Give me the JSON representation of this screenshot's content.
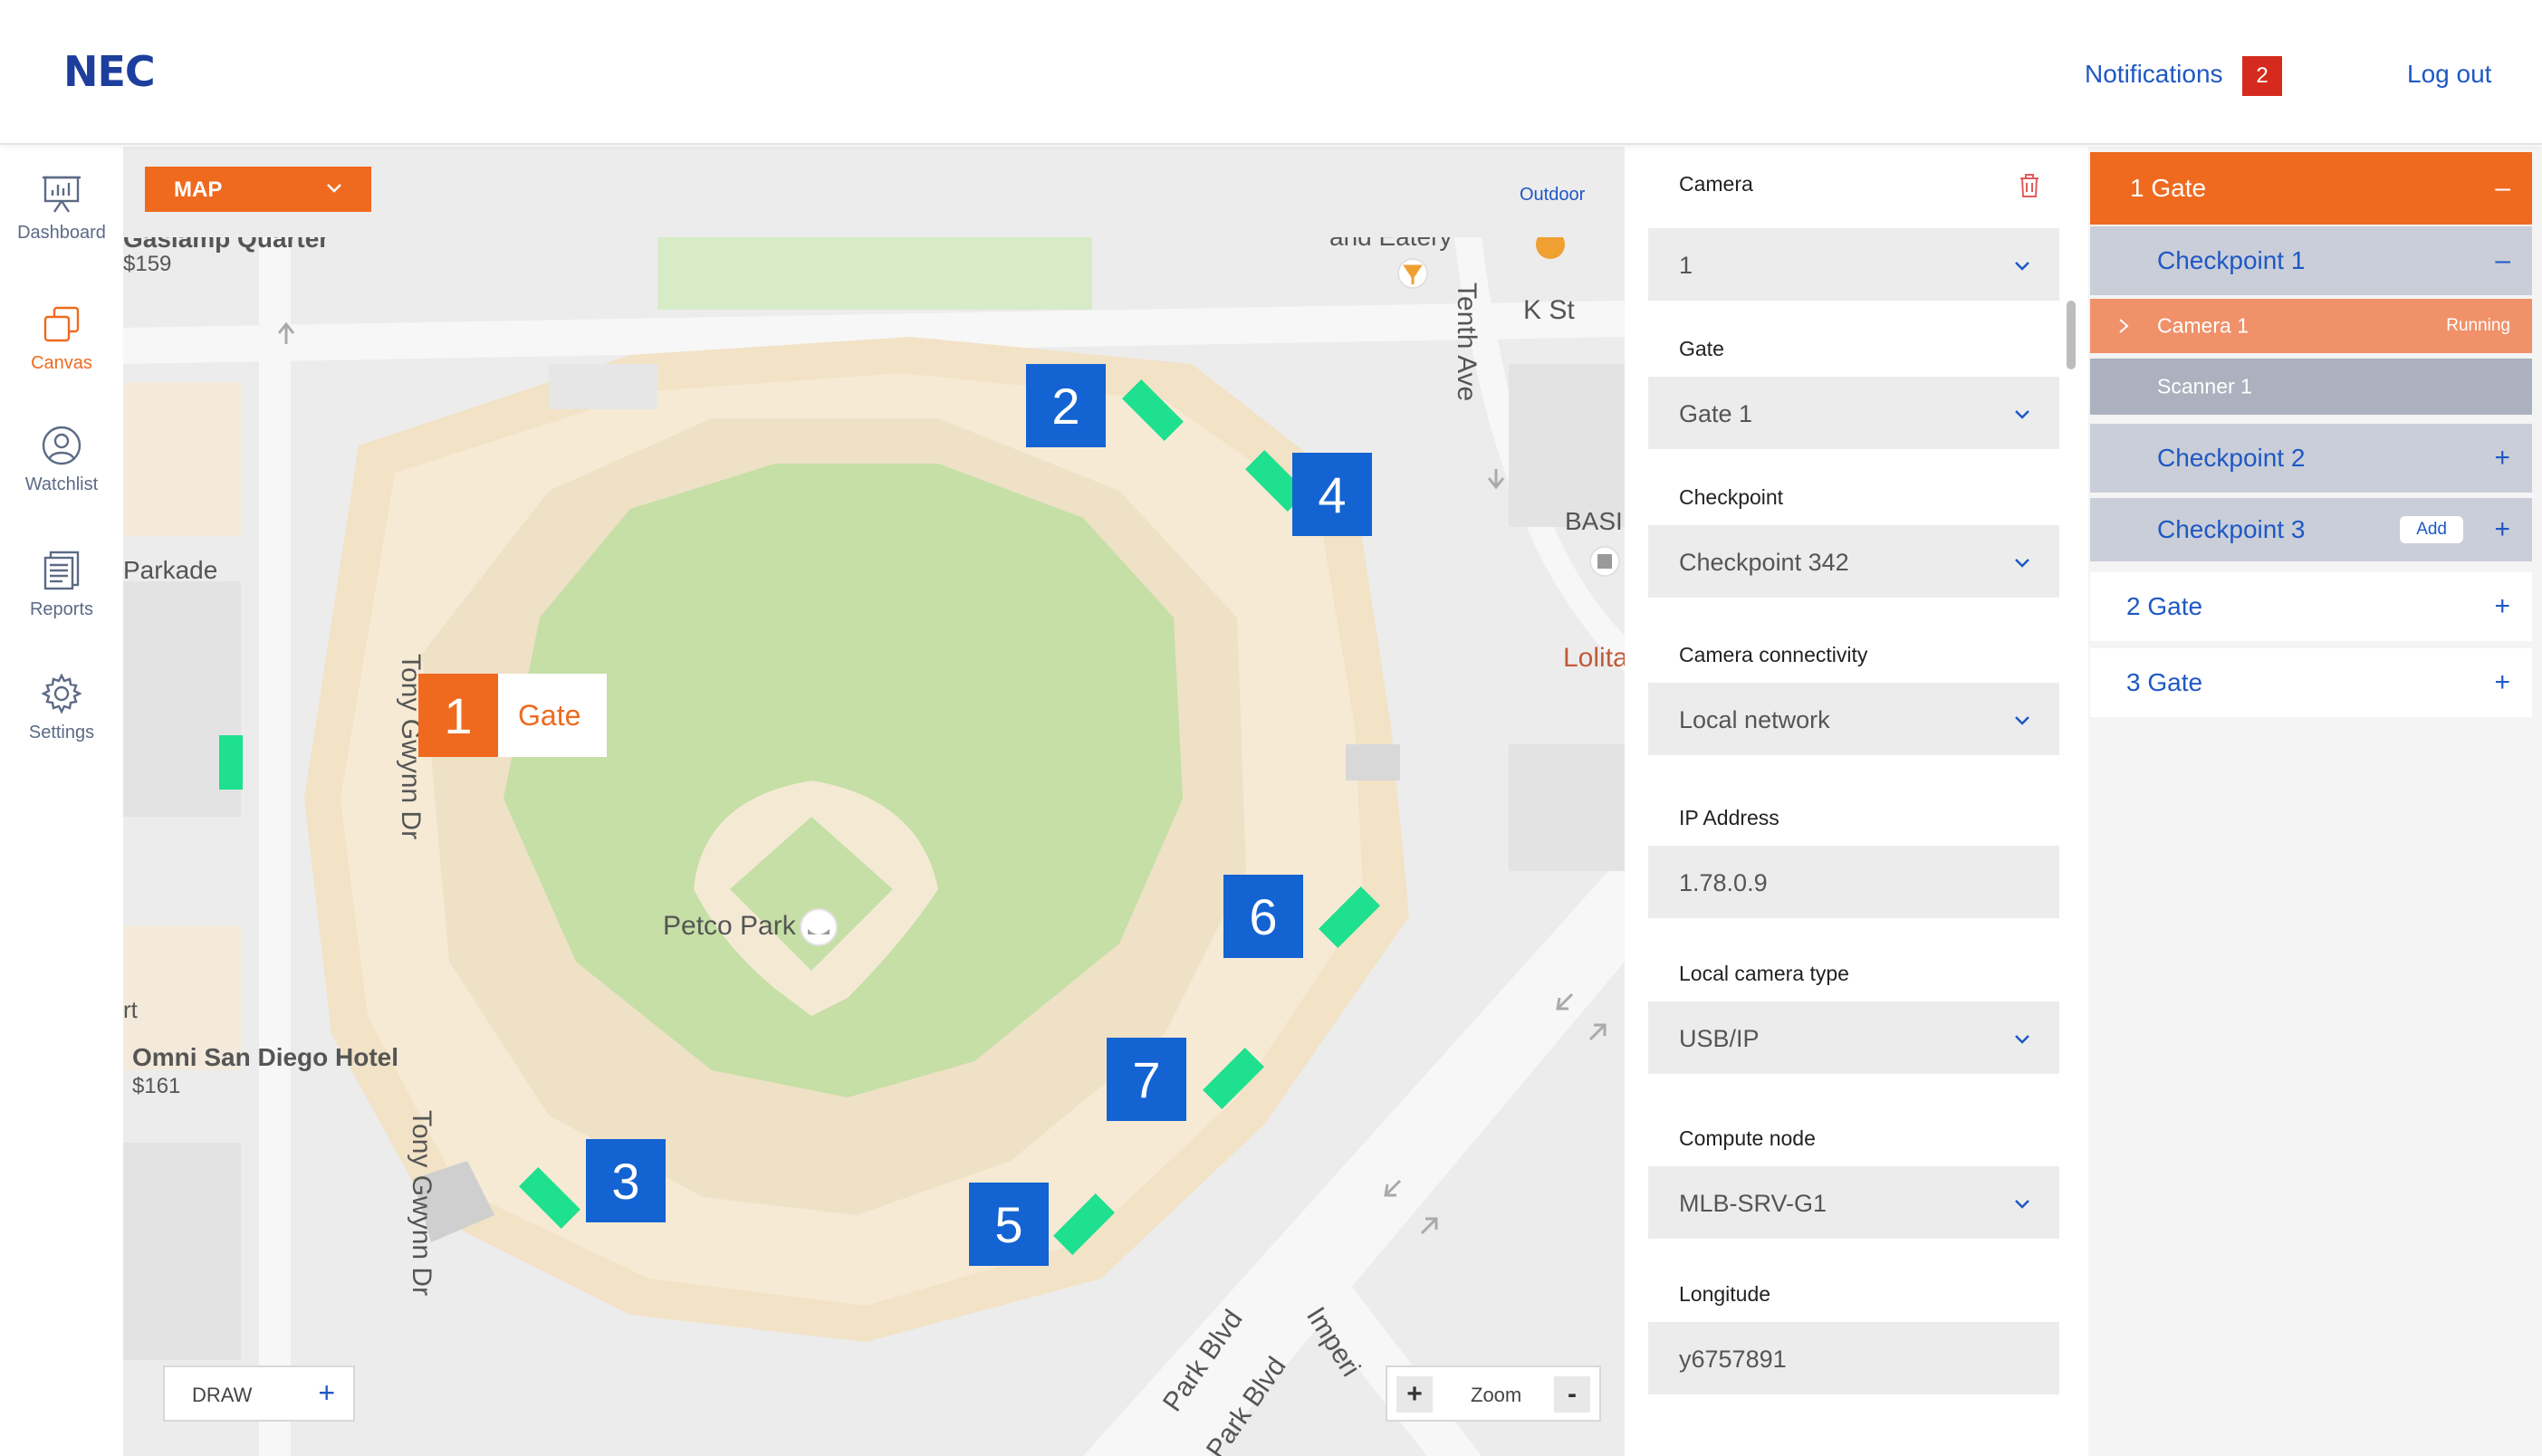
{
  "header": {
    "logo": "NEC",
    "notifications_label": "Notifications",
    "notifications_count": "2",
    "logout_label": "Log out"
  },
  "nav": {
    "items": [
      {
        "label": "Dashboard",
        "icon": "dashboard-icon"
      },
      {
        "label": "Canvas",
        "icon": "canvas-icon",
        "active": true
      },
      {
        "label": "Watchlist",
        "icon": "watchlist-icon"
      },
      {
        "label": "Reports",
        "icon": "reports-icon"
      },
      {
        "label": "Settings",
        "icon": "gear-icon"
      }
    ]
  },
  "map": {
    "view_select": "MAP",
    "outdoor_link": "Outdoor",
    "draw_label": "DRAW",
    "zoom_label": "Zoom",
    "zoom_in": "+",
    "zoom_out": "-",
    "labels": {
      "gaslamp": "Gaslamp Quarter",
      "gaslamp_price": "$159",
      "eatery": "and Eatery",
      "k_st": "K St",
      "tenth_ave": "Tenth Ave",
      "basi": "BASI",
      "lolita": "Lolita",
      "parkade": "Parkade",
      "tony_gwynn_1": "Tony Gwynn Dr",
      "tony_gwynn_2": "Tony Gwynn Dr",
      "petco": "Petco Park",
      "rt": "rt",
      "omni": "Omni San Diego Hotel",
      "omni_price": "$161",
      "park_blvd_1": "Park Blvd",
      "park_blvd_2": "Park Blvd",
      "imperial": "Imperi"
    },
    "markers": [
      {
        "num": "1",
        "tag": "Gate"
      },
      {
        "num": "2"
      },
      {
        "num": "3"
      },
      {
        "num": "4"
      },
      {
        "num": "5"
      },
      {
        "num": "6"
      },
      {
        "num": "7"
      }
    ],
    "colors": {
      "marker_blue": "#1463d2",
      "marker_orange": "#ef6a1f",
      "camera_green": "#1ee08f"
    }
  },
  "form": {
    "camera": {
      "label": "Camera",
      "value": "1"
    },
    "gate": {
      "label": "Gate",
      "value": "Gate 1"
    },
    "checkpoint": {
      "label": "Checkpoint",
      "value": "Checkpoint 342"
    },
    "connectivity": {
      "label": "Camera connectivity",
      "value": "Local network"
    },
    "ip": {
      "label": "IP Address",
      "value": "1.78.0.9"
    },
    "cam_type": {
      "label": "Local camera type",
      "value": "USB/IP"
    },
    "compute": {
      "label": "Compute node",
      "value": "MLB-SRV-G1"
    },
    "longitude": {
      "label": "Longitude",
      "value": "y6757891"
    }
  },
  "tree": {
    "gate1": {
      "label": "1 Gate",
      "action": "–"
    },
    "checkpoint1": {
      "label": "Checkpoint 1",
      "action": "–"
    },
    "camera1": {
      "label": "Camera 1",
      "status": "Running"
    },
    "scanner1": {
      "label": "Scanner 1"
    },
    "checkpoint2": {
      "label": "Checkpoint 2",
      "action": "+"
    },
    "checkpoint3": {
      "label": "Checkpoint 3",
      "add_label": "Add",
      "action": "+"
    },
    "gate2": {
      "label": "2 Gate",
      "action": "+"
    },
    "gate3": {
      "label": "3 Gate",
      "action": "+"
    }
  }
}
